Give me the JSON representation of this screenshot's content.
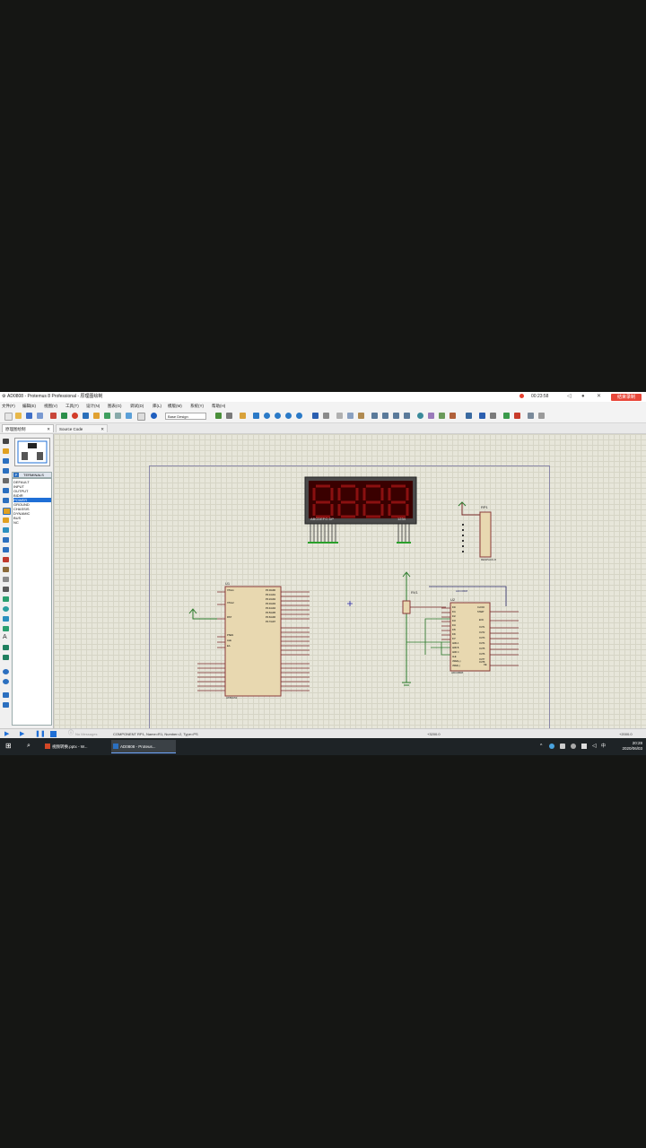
{
  "window": {
    "title": "AD0808 - Protemus 8 Professional - 原理图绘制",
    "timer": "00:23:58",
    "end_button": "结束录制"
  },
  "menu": [
    "文件(F)",
    "编辑(E)",
    "视图(V)",
    "工具(T)",
    "设计(N)",
    "图表(G)",
    "调试(D)",
    "库(L)",
    "模版(M)",
    "系统(Y)",
    "帮助(H)"
  ],
  "toolbar": {
    "design_select": "Base Design"
  },
  "tabs": [
    {
      "label": "原理图绘制"
    },
    {
      "label": "Source Code"
    }
  ],
  "device_panel": {
    "header_button": "P",
    "list_title": "TERMINALS",
    "items": [
      "DEFAULT",
      "INPUT",
      "OUTPUT",
      "BIDIR",
      "POWER",
      "GROUND",
      "CHASSIS",
      "DYNAMIC",
      "BUS",
      "NC"
    ],
    "selected_index": 4
  },
  "schematic": {
    "display_digits": "8888",
    "display_label_left": "ABCDEFG DP",
    "display_label_right": "1234",
    "rp_label": "RP1",
    "rp_sub": "RESPACK-8",
    "rv_label": "RV1",
    "u1_label": "U1",
    "u1_part": "AT89C51",
    "u2_label": "U2",
    "u2_part": "ADC0808",
    "u2_chip": "ADC0808",
    "u1_left_pins": [
      "XTAL1",
      "XTAL2",
      "RST",
      "PSEN",
      "ALE",
      "EA"
    ],
    "u1_right_pins": [
      "P0.0/AD0",
      "P0.1/AD1",
      "P0.2/AD2",
      "P0.3/AD3",
      "P0.4/AD4",
      "P0.5/AD5",
      "P0.6/AD6",
      "P0.7/AD7"
    ],
    "u2_left_pins": [
      "IN0",
      "IN1",
      "IN2",
      "IN3",
      "IN4",
      "IN5",
      "IN6",
      "IN7",
      "ADD A",
      "ADD B",
      "ADD C",
      "ALE",
      "VREF(+)",
      "VREF(-)"
    ],
    "u2_right_pins": [
      "CLOCK",
      "START",
      "EOC",
      "OUT1",
      "OUT2",
      "OUT3",
      "OUT4",
      "OUT5",
      "OUT6",
      "OUT7",
      "OUT8",
      "OE"
    ]
  },
  "status": {
    "messages": "No Messages",
    "component": "COMPONENT RP1, Name=R1, Number=2, Type=PS",
    "coord_x": "+3200.0",
    "coord_y": "+2000.0"
  },
  "taskbar": {
    "items": [
      {
        "label": "视频转换.pptx - W..."
      },
      {
        "label": "AD0808 - Proteus..."
      }
    ],
    "time": "20:28",
    "date": "2020/06/03"
  }
}
